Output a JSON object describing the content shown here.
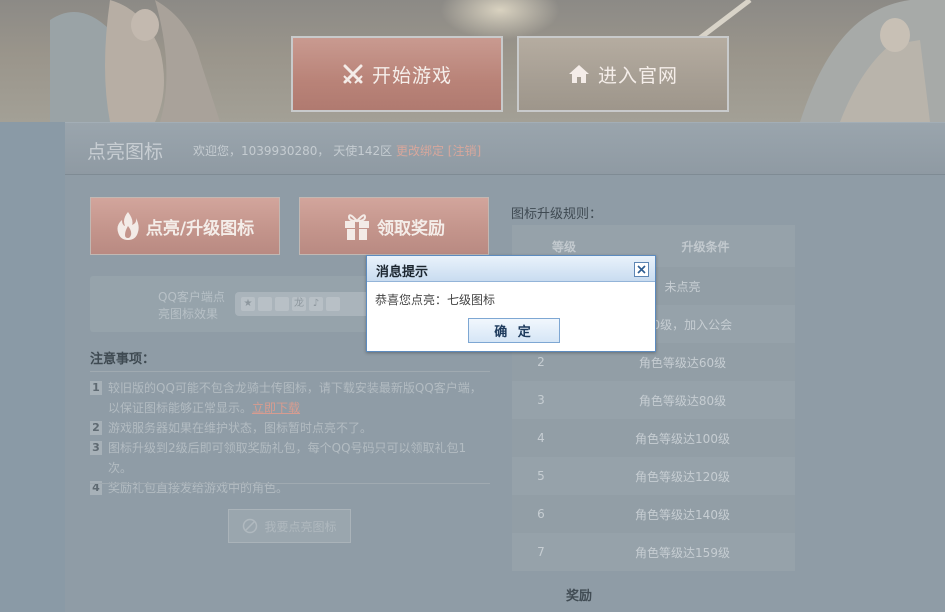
{
  "hero": {
    "start_game_label": "开始游戏",
    "official_site_label": "进入官网"
  },
  "header": {
    "title": "点亮图标",
    "welcome_prefix": "欢迎您，",
    "qq_number": "1039930280",
    "separator": "，",
    "server": "天使142区",
    "change_binding": "更改绑定",
    "logout": "[注销]"
  },
  "actions": {
    "light_upgrade_label": "点亮/升级图标",
    "claim_reward_label": "领取奖励"
  },
  "qq_client": {
    "label": "QQ客户端点亮图标效果"
  },
  "notes": {
    "title": "注意事项：",
    "items": [
      {
        "num": "1",
        "text": "较旧版的QQ可能不包含龙骑士传图标，请下载安装最新版QQ客户端，以保证图标能够正常显示。",
        "link": "立即下载"
      },
      {
        "num": "2",
        "text": "游戏服务器如果在维护状态，图标暂时点亮不了。"
      },
      {
        "num": "3",
        "text": "图标升级到2级后即可领取奖励礼包，每个QQ号码只可以领取礼包1次。"
      },
      {
        "num": "4",
        "text": "奖励礼包直接发给游戏中的角色。"
      }
    ],
    "light_button": "我要点亮图标"
  },
  "rules": {
    "title": "图标升级规则：",
    "headers": {
      "level": "等级",
      "condition": "升级条件"
    },
    "rows": [
      {
        "level": "",
        "condition": "未点亮"
      },
      {
        "level": "",
        "condition": "达40级，加入公会"
      },
      {
        "level": "2",
        "condition": "角色等级达60级"
      },
      {
        "level": "3",
        "condition": "角色等级达80级"
      },
      {
        "level": "4",
        "condition": "角色等级达100级"
      },
      {
        "level": "5",
        "condition": "角色等级达120级"
      },
      {
        "level": "6",
        "condition": "角色等级达140级"
      },
      {
        "level": "7",
        "condition": "角色等级达159级"
      }
    ],
    "reward_label": "奖励"
  },
  "modal": {
    "title": "消息提示",
    "message": "恭喜您点亮：七级图标",
    "ok_label": "确 定"
  },
  "colors": {
    "accent_link": "#d7a79c",
    "button_pink": "#c4958c",
    "overlay_bg": "#8f9ca6",
    "modal_border": "#5c8bbf"
  }
}
